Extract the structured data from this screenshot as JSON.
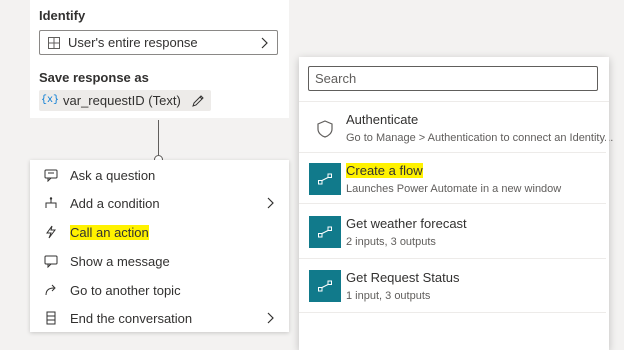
{
  "identify": {
    "label": "Identify",
    "value": "User's entire response"
  },
  "save_response": {
    "label": "Save response as",
    "var_icon": "{x}",
    "variable": "var_requestID (Text)"
  },
  "node_menu": {
    "items": [
      {
        "label": "Ask a question",
        "icon": "question-icon",
        "submenu": false,
        "highlighted": false
      },
      {
        "label": "Add a condition",
        "icon": "condition-icon",
        "submenu": true,
        "highlighted": false
      },
      {
        "label": "Call an action",
        "icon": "lightning-icon",
        "submenu": false,
        "highlighted": true
      },
      {
        "label": "Show a message",
        "icon": "message-icon",
        "submenu": false,
        "highlighted": false
      },
      {
        "label": "Go to another topic",
        "icon": "redirect-icon",
        "submenu": false,
        "highlighted": false
      },
      {
        "label": "End the conversation",
        "icon": "end-icon",
        "submenu": true,
        "highlighted": false
      }
    ]
  },
  "action_picker": {
    "search_placeholder": "Search",
    "items": [
      {
        "title": "Authenticate",
        "subtitle": "Go to Manage > Authentication to connect an Identity...",
        "icon": "shield-icon",
        "highlighted": false
      },
      {
        "title": "Create a flow",
        "subtitle": "Launches Power Automate in a new window",
        "icon": "flow-icon",
        "highlighted": true
      },
      {
        "title": "Get weather forecast",
        "subtitle": "2 inputs, 3 outputs",
        "icon": "flow-icon",
        "highlighted": false
      },
      {
        "title": "Get Request Status",
        "subtitle": "1 input, 3 outputs",
        "icon": "flow-icon",
        "highlighted": false
      }
    ]
  },
  "colors": {
    "accent": "#0078d4",
    "flow_tile": "#117a8b",
    "highlight": "#fff200",
    "background": "#f3f2f1"
  }
}
